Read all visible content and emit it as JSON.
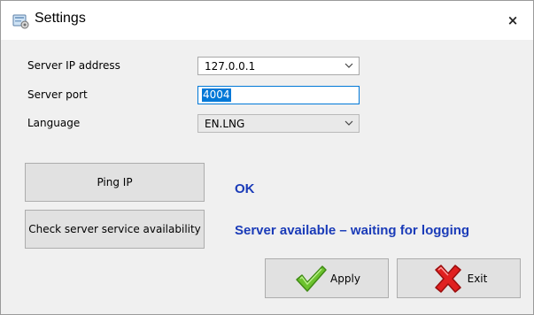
{
  "window": {
    "title": "Settings",
    "icon": "settings-app-icon",
    "close_label": "×"
  },
  "form": {
    "server_ip": {
      "label": "Server IP address",
      "value": "127.0.0.1"
    },
    "server_port": {
      "label": "Server port",
      "value": "4004"
    },
    "language": {
      "label": "Language",
      "value": "EN.LNG"
    }
  },
  "actions": {
    "ping_label": "Ping IP",
    "check_label": "Check server service availability",
    "apply_label": "Apply",
    "exit_label": "Exit"
  },
  "status": {
    "ping_result": "OK",
    "service_result": "Server available – waiting for logging"
  },
  "colors": {
    "status_text": "#1a3bb8",
    "focus_border": "#0078d7",
    "selection": "#0078d7",
    "apply_check": "#6cc22e",
    "exit_cross": "#e02020"
  }
}
